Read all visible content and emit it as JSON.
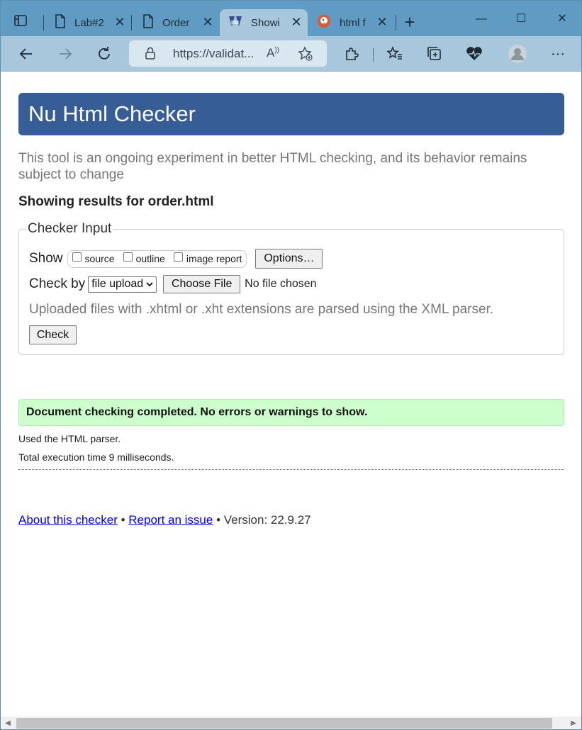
{
  "browser": {
    "tabs": [
      {
        "label": "Lab#2"
      },
      {
        "label": "Order"
      },
      {
        "label": "Showi"
      },
      {
        "label": "html f"
      }
    ],
    "new_tab": "+",
    "address": "https://validat...",
    "window_buttons": {
      "minimize": "—",
      "maximize": "☐",
      "close": "✕"
    }
  },
  "page": {
    "title": "Nu Html Checker",
    "intro": "This tool is an ongoing experiment in better HTML checking, and its behavior remains subject to change",
    "results_heading": "Showing results for order.html",
    "checker_input": {
      "legend": "Checker Input",
      "show_label": "Show",
      "show_options": [
        "source",
        "outline",
        "image report"
      ],
      "options_button": "Options…",
      "check_by_label": "Check by",
      "check_by_value": "file upload",
      "choose_file_button": "Choose File",
      "no_file_text": "No file chosen",
      "hint": "Uploaded files with .xhtml or .xht extensions are parsed using the XML parser.",
      "check_button": "Check"
    },
    "success_message": "Document checking completed. No errors or warnings to show.",
    "parser_note": "Used the HTML parser.",
    "execution_time": "Total execution time 9 milliseconds.",
    "footer": {
      "about_link": "About this checker",
      "sep1": " • ",
      "report_link": "Report an issue",
      "version": " • Version: 22.9.27"
    }
  },
  "colors": {
    "tabstrip": "#5f9bc2",
    "toolbar": "#a9c7dc",
    "banner": "#365d95",
    "success": "#ccffcc",
    "link": "#0000ee"
  }
}
